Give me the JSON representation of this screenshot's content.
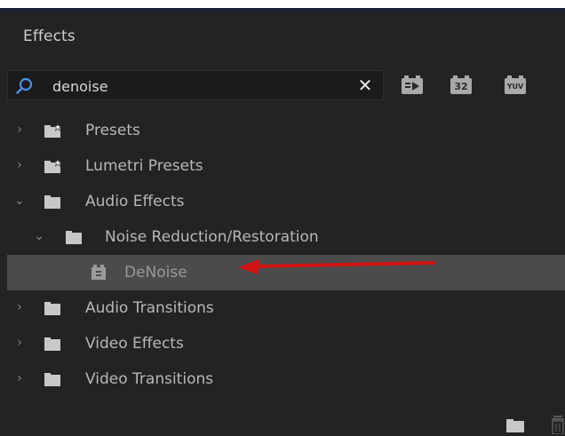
{
  "panel": {
    "title": "Effects"
  },
  "search": {
    "value": "denoise",
    "placeholder": "",
    "clear_symbol": "✕"
  },
  "filter_buttons": [
    {
      "name": "accelerated-effects",
      "label": ""
    },
    {
      "name": "32-bit-color",
      "label": "32"
    },
    {
      "name": "yuv-effects",
      "label": "YUV"
    }
  ],
  "tree": {
    "items": [
      {
        "label": "Presets",
        "expanded": false,
        "icon": "preset-folder-icon"
      },
      {
        "label": "Lumetri Presets",
        "expanded": false,
        "icon": "preset-folder-icon"
      },
      {
        "label": "Audio Effects",
        "expanded": true,
        "icon": "folder-icon"
      },
      {
        "label": "Noise Reduction/Restoration",
        "expanded": true,
        "icon": "folder-icon"
      },
      {
        "label": "DeNoise",
        "selected": true,
        "icon": "audio-effect-icon"
      },
      {
        "label": "Audio Transitions",
        "expanded": false,
        "icon": "folder-icon"
      },
      {
        "label": "Video Effects",
        "expanded": false,
        "icon": "folder-icon"
      },
      {
        "label": "Video Transitions",
        "expanded": false,
        "icon": "folder-icon"
      }
    ]
  },
  "colors": {
    "panel_bg": "#232323",
    "selected_row": "#4b4b4b",
    "search_icon": "#4a8fe7",
    "annotation_arrow": "#d11414"
  }
}
